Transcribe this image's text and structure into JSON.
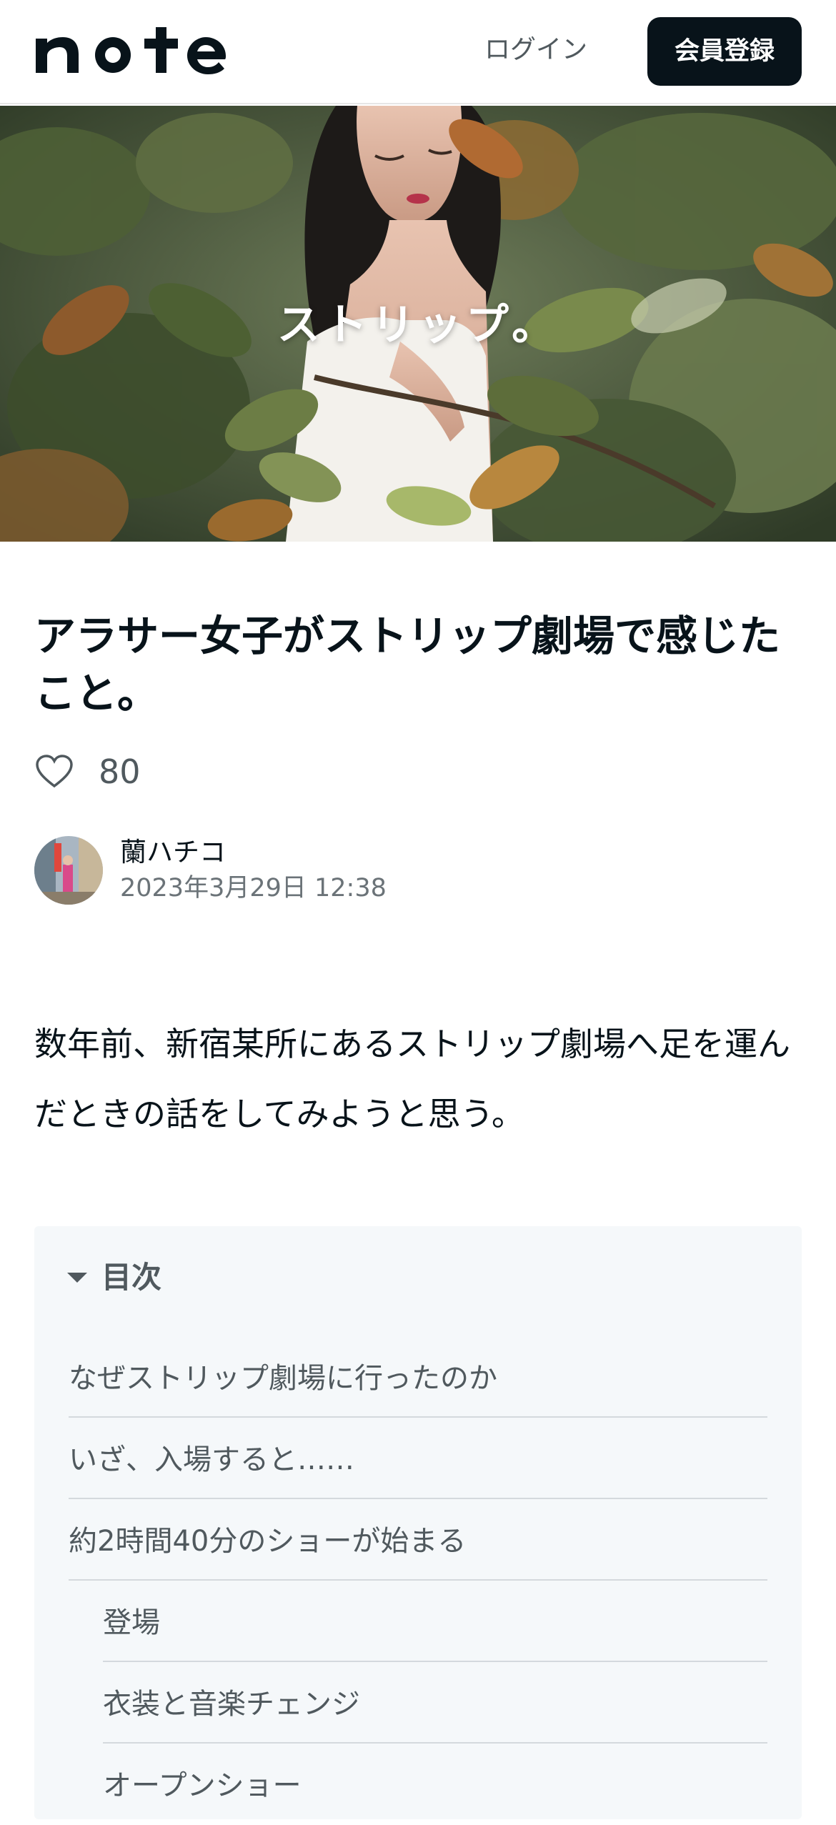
{
  "header": {
    "logo_text": "note",
    "login_label": "ログイン",
    "signup_label": "会員登録"
  },
  "hero": {
    "overlay_text": "ストリップ。"
  },
  "article": {
    "title": "アラサー女子がストリップ劇場で感じたこと。",
    "like_count": "80",
    "author_name": "蘭ハチコ",
    "published": "2023年3月29日 12:38",
    "body": "数年前、新宿某所にあるストリップ劇場へ足を運んだときの話をしてみようと思う。"
  },
  "toc": {
    "title": "目次",
    "items": [
      {
        "label": "なぜストリップ劇場に行ったのか",
        "level": 1
      },
      {
        "label": "いざ、入場すると……",
        "level": 1
      },
      {
        "label": "約2時間40分のショーが始まる",
        "level": 1
      },
      {
        "label": "登場",
        "level": 2
      },
      {
        "label": "衣装と音楽チェンジ",
        "level": 2
      },
      {
        "label": "オープンショー",
        "level": 2
      }
    ]
  },
  "colors": {
    "text": "#08131a",
    "sub_text": "#50595e",
    "signup_bg": "#08131a",
    "toc_bg": "#f5f8fa"
  },
  "icons": [
    "note-logo",
    "heart-icon",
    "chevron-down-icon"
  ]
}
